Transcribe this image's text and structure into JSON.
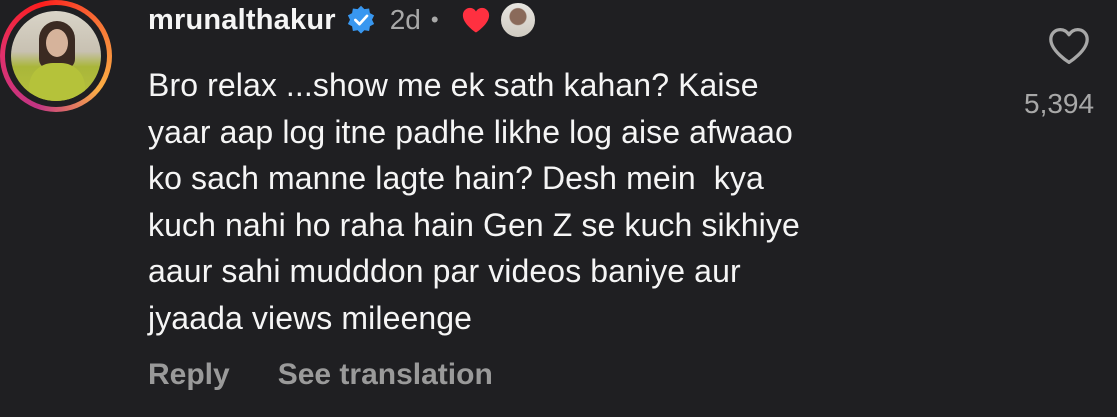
{
  "comment": {
    "username": "mrunalthakur",
    "verified": true,
    "time": "2d",
    "separator": "•",
    "author_liked": true,
    "text": "Bro relax ...show me ek sath kahan? Kaise\nyaar aap log itne padhe likhe log aise afwaao\nko sach manne lagte hain? Desh mein  kya\nkuch nahi ho raha hain Gen Z se kuch sikhiye\naaur sahi mudddon par videos baniye aur\njyaada views mileenge",
    "actions": {
      "reply_label": "Reply",
      "translate_label": "See translation"
    },
    "like_count": "5,394"
  },
  "colors": {
    "background": "#1f1f22",
    "text": "#f5f5f5",
    "muted": "#a8a8a8",
    "verified_blue": "#3897f0",
    "heart_red": "#ff3040"
  },
  "icons": {
    "verified": "verified-badge-icon",
    "author_heart": "heart-filled-icon",
    "like": "heart-outline-icon"
  }
}
